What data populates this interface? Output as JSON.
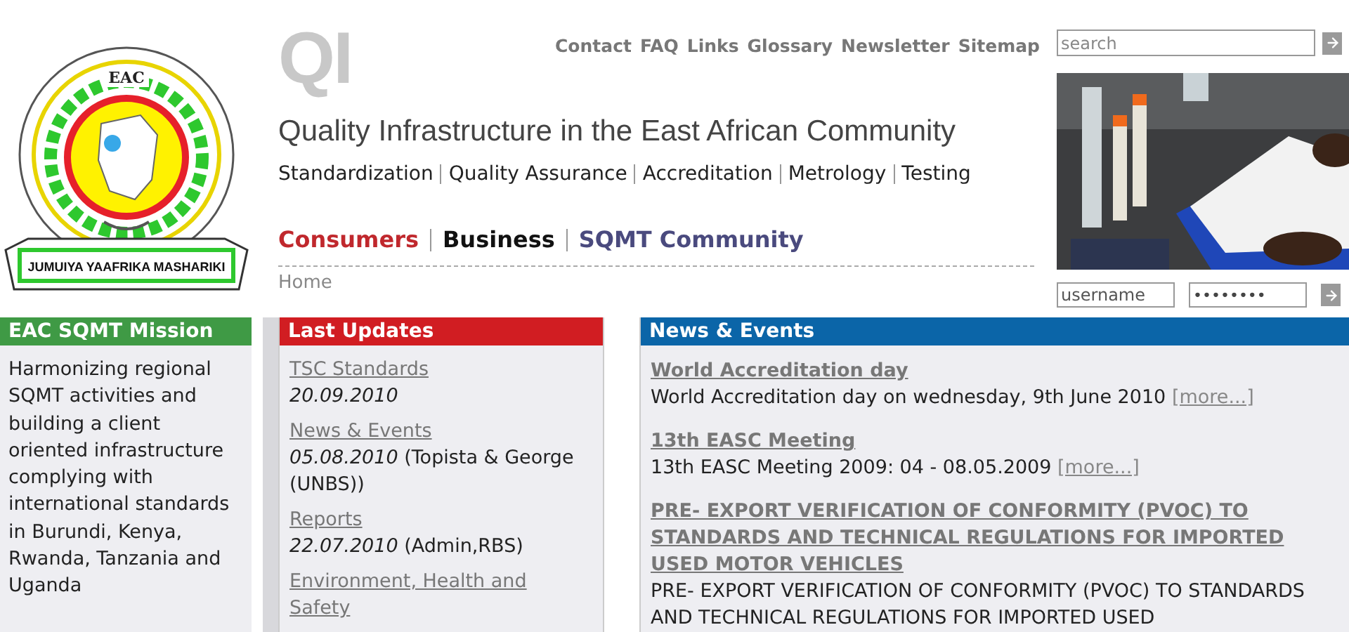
{
  "emblem": {
    "top_text": "EAC",
    "banner_text": "JUMUIYA YAAFRIKA MASHARIKI"
  },
  "qi_logo": {
    "text": "QI"
  },
  "top_links": [
    "Contact",
    "FAQ",
    "Links",
    "Glossary",
    "Newsletter",
    "Sitemap"
  ],
  "search": {
    "placeholder": "search"
  },
  "title": "Quality Infrastructure in the East African Community",
  "subtitle_links": [
    "Standardization",
    "Quality Assurance",
    "Accreditation",
    "Metrology",
    "Testing"
  ],
  "nav": [
    {
      "label": "Consumers",
      "color": "#c0282d"
    },
    {
      "label": "Business",
      "color": "#111111"
    },
    {
      "label": "SQMT Community",
      "color": "#4a4a7e"
    }
  ],
  "breadcrumb": "Home",
  "login": {
    "username_placeholder": "username",
    "password_value": "••••••••"
  },
  "mission": {
    "title": "EAC SQMT Mission",
    "text": "Harmonizing regional SQMT activities and building a client oriented infrastructure complying with international standards in Burundi, Kenya, Rwanda, Tanzania and Uganda"
  },
  "updates": {
    "title": "Last Updates",
    "items": [
      {
        "link": "TSC Standards",
        "date": "20.09.2010"
      },
      {
        "link": "News & Events",
        "date": "05.08.2010",
        "note": "(Topista & George (UNBS))"
      },
      {
        "link": "Reports",
        "date": "22.07.2010",
        "note": "(Admin,RBS)"
      },
      {
        "link": "Environment, Health and Safety"
      }
    ]
  },
  "news": {
    "title": "News & Events",
    "items": [
      {
        "headline": "World Accreditation day",
        "text": "World Accreditation day on wednesday, 9th June 2010",
        "more": "[more...]"
      },
      {
        "headline": "13th EASC Meeting",
        "text": "13th EASC Meeting 2009: 04 - 08.05.2009",
        "more": "[more...]"
      },
      {
        "headline": "PRE- EXPORT VERIFICATION OF CONFORMITY (PVOC) TO STANDARDS AND TECHNICAL REGULATIONS FOR IMPORTED USED MOTOR VEHICLES",
        "text": "PRE- EXPORT VERIFICATION OF CONFORMITY (PVOC) TO STANDARDS AND TECHNICAL REGULATIONS FOR IMPORTED USED"
      }
    ]
  }
}
